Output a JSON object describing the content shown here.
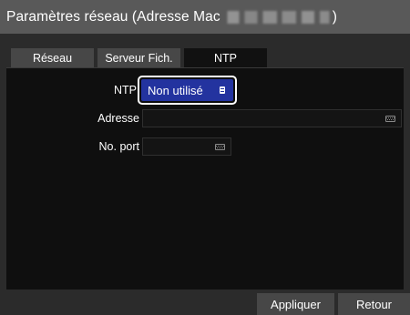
{
  "window": {
    "title_prefix": "Paramètres réseau (Adresse Mac",
    "title_suffix": ")"
  },
  "tabs": [
    {
      "label": "Réseau",
      "active": false
    },
    {
      "label": "Serveur Fich.",
      "active": false
    },
    {
      "label": "NTP",
      "active": true
    }
  ],
  "form": {
    "ntp_label": "NTP",
    "ntp_value": "Non utilisé",
    "address_label": "Adresse",
    "address_value": "",
    "port_label": "No. port",
    "port_value": ""
  },
  "buttons": {
    "apply": "Appliquer",
    "back": "Retour"
  },
  "colors": {
    "title_bar": "#595959",
    "dialog_bg": "#2b2b2b",
    "panel_bg": "#0f0f0f",
    "tab_inactive": "#474747",
    "selection_blue": "#23339f"
  },
  "icons": [
    "list-icon",
    "keyboard-icon"
  ]
}
